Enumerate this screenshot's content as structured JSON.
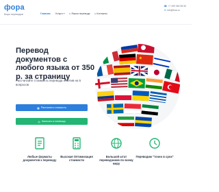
{
  "header": {
    "logo_title": "фора",
    "logo_subtitle": "Бюро переводов",
    "nav": [
      {
        "label": "Главная",
        "active": true,
        "icon": ""
      },
      {
        "label": "Услуги",
        "active": false,
        "icon": "chevron-down-icon"
      },
      {
        "label": "Языки перевода",
        "active": false,
        "icon": "language-icon"
      },
      {
        "label": "Контакты",
        "active": false,
        "icon": "phone-icon"
      }
    ],
    "phone": "+7 499 350 55 50",
    "email": "info@fora.ru"
  },
  "hero": {
    "title": "Перевод документов с любого языка от 350 р. за страницу",
    "subtitle": "Рассчитайте стоимость перевода ответив на 5 вопросов",
    "calc_button": "Рассчитать стоимость",
    "manager_button": "Написать в whatsapp"
  },
  "features": [
    {
      "text": "Любые форматы документов к переводу",
      "icon": "document-icon"
    },
    {
      "text": "Высокая Оптимизация стоимости",
      "icon": "calculator-icon"
    },
    {
      "text": "Большой штат переводчиков по всему миру",
      "icon": "globe-icon"
    },
    {
      "text": "Переводим \"точно в срок\"",
      "icon": "clock-icon"
    }
  ],
  "colors": {
    "accent": "#2e7fdc",
    "whatsapp": "#22b573",
    "title": "#1e2736"
  }
}
